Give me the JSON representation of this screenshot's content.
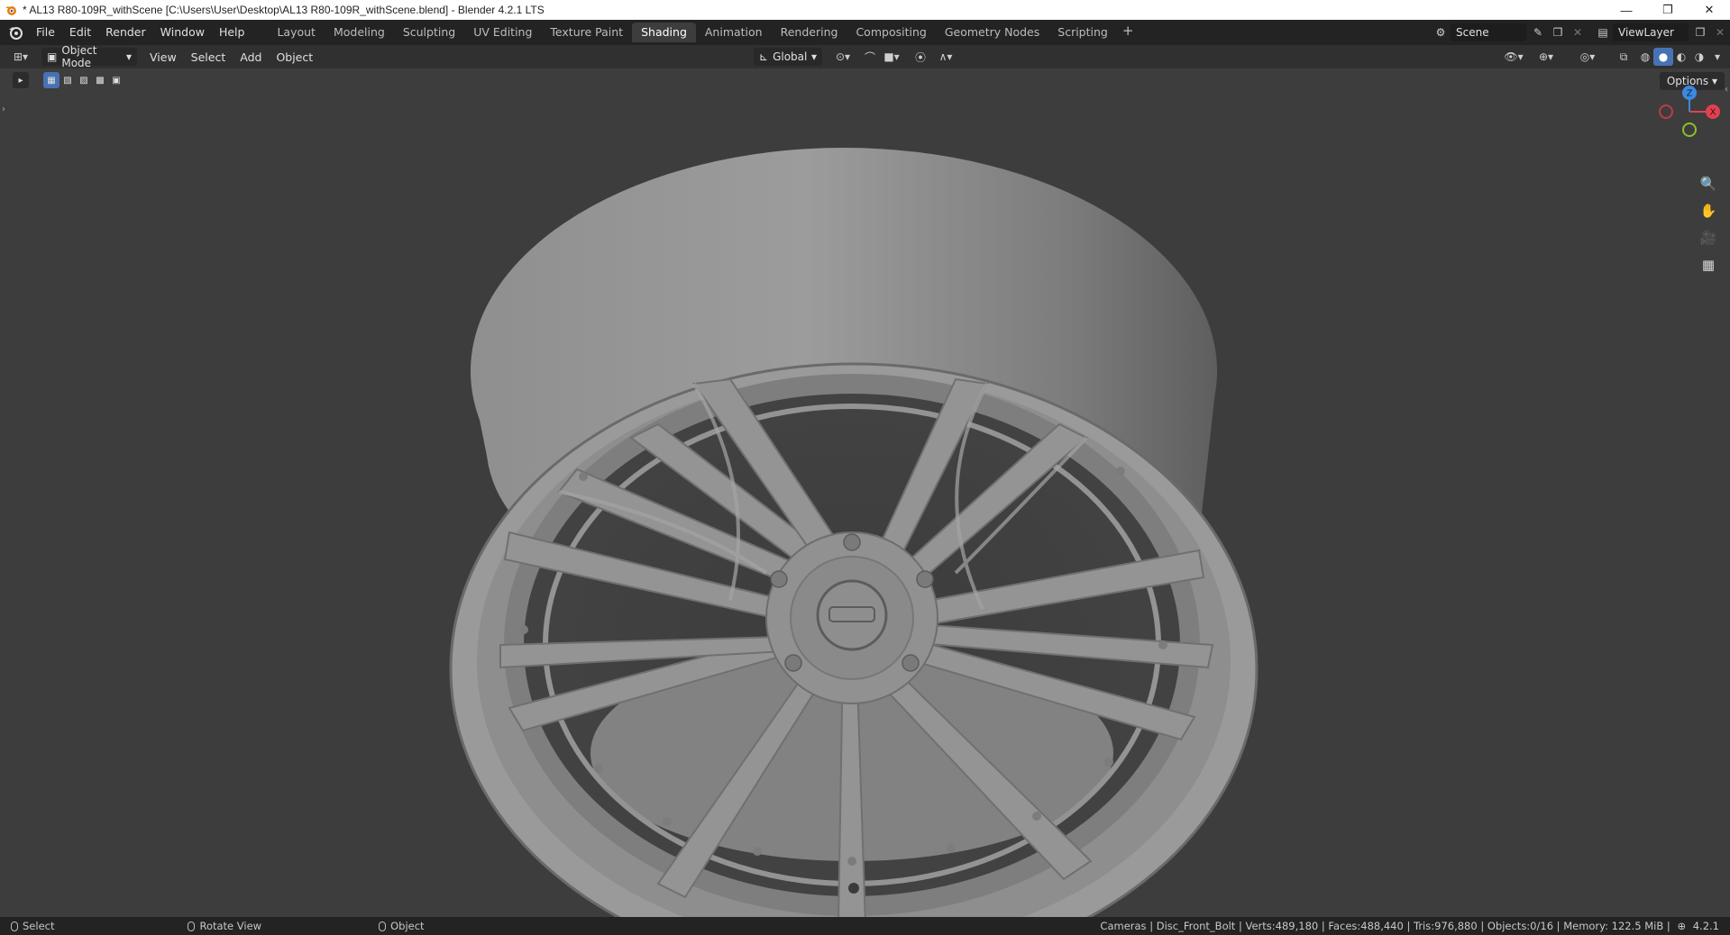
{
  "window": {
    "title": "* AL13 R80-109R_withScene [C:\\Users\\User\\Desktop\\AL13 R80-109R_withScene.blend] - Blender 4.2.1 LTS",
    "minimize": "—",
    "maximize": "❐",
    "close": "✕"
  },
  "menu": [
    "File",
    "Edit",
    "Render",
    "Window",
    "Help"
  ],
  "workspaces": [
    "Layout",
    "Modeling",
    "Sculpting",
    "UV Editing",
    "Texture Paint",
    "Shading",
    "Animation",
    "Rendering",
    "Compositing",
    "Geometry Nodes",
    "Scripting"
  ],
  "active_workspace": "Shading",
  "scene": {
    "label": "Scene",
    "view_layer": "ViewLayer"
  },
  "header": {
    "mode": "Object Mode",
    "menus": [
      "View",
      "Select",
      "Add",
      "Object"
    ],
    "orientation": "Global"
  },
  "viewport": {
    "options_label": "Options",
    "gizmo": {
      "z": "Z",
      "x": "X"
    }
  },
  "statusbar": {
    "hints": [
      "Select",
      "Rotate View",
      "Object"
    ],
    "stats": "Cameras | Disc_Front_Bolt | Verts:489,180 | Faces:488,440 | Tris:976,880 | Objects:0/16 | Memory: 122.5 MiB |",
    "version": "4.2.1"
  },
  "colors": {
    "accent": "#4772b3",
    "axis_x": "#e0404f",
    "axis_y": "#8bbf2f",
    "axis_z": "#3b8ae0"
  }
}
